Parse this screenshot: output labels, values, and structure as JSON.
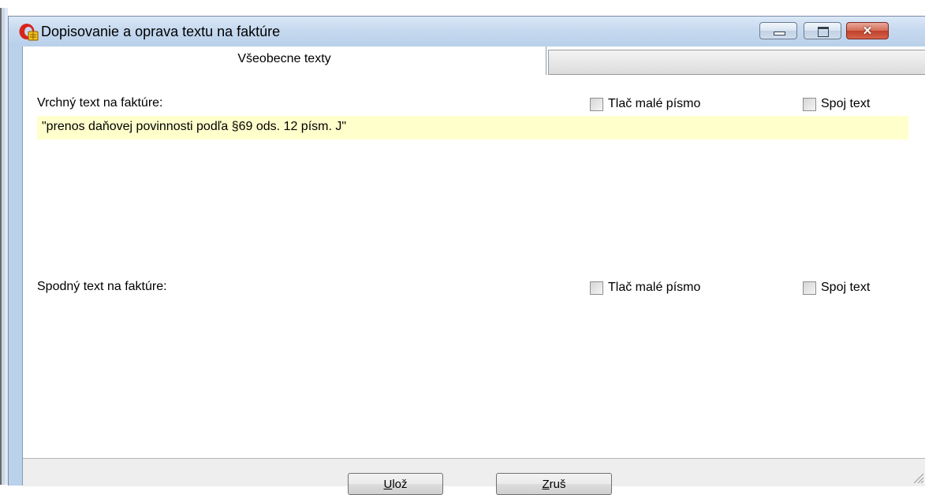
{
  "window": {
    "title": "Dopisovanie a oprava textu na faktúre",
    "icon": "app-icon"
  },
  "tabs": [
    {
      "label": "Všeobecne texty",
      "active": true
    },
    {
      "label": "",
      "active": false
    }
  ],
  "top_section": {
    "label": "Vrchný text na faktúre:",
    "small_print_label": "Tlač malé písmo",
    "small_print_checked": false,
    "join_label": "Spoj text",
    "join_checked": false,
    "value": "\"prenos daňovej povinnosti podľa §69 ods. 12 písm. J\""
  },
  "bottom_section": {
    "label": "Spodný text na faktúre:",
    "small_print_label": "Tlač malé písmo",
    "small_print_checked": false,
    "join_label": "Spoj text",
    "join_checked": false,
    "value": ""
  },
  "buttons": {
    "save_mnemonic": "U",
    "save_rest": "lož",
    "cancel_mnemonic": "Z",
    "cancel_rest": "ruš"
  },
  "colors": {
    "text_area_bg": "#ffffcc",
    "titlebar": "#c6d9ef",
    "close_button": "#c0402a"
  }
}
